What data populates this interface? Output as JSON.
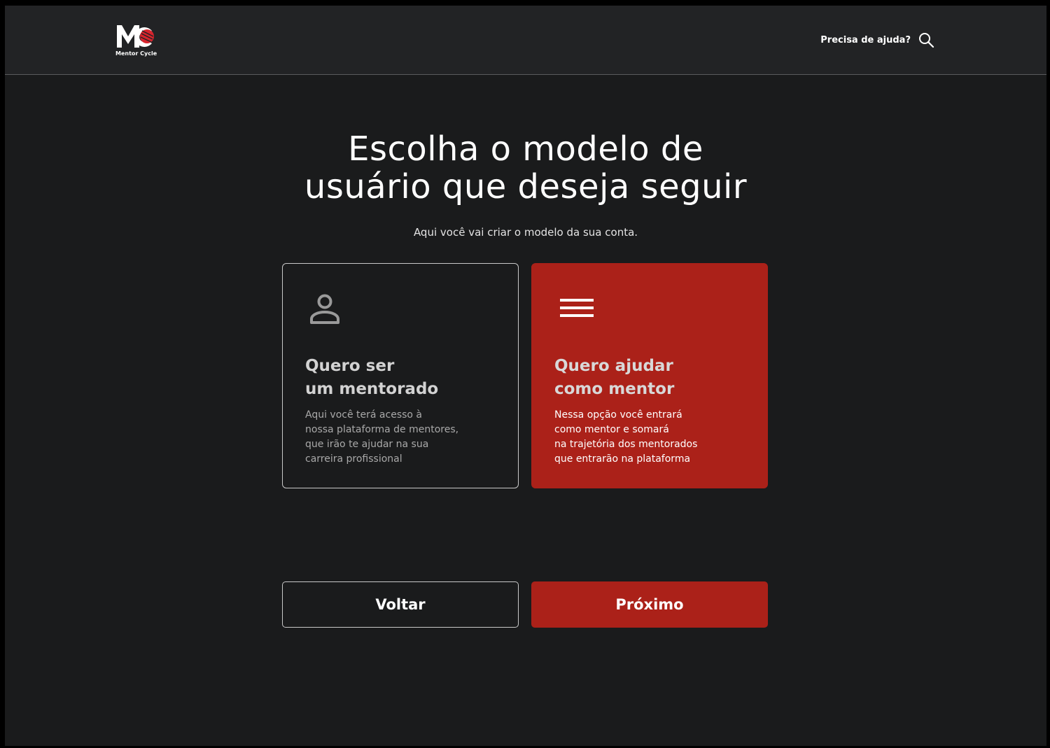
{
  "header": {
    "logo_caption": "Mentor Cycle",
    "help_text": "Precisa de ajuda?",
    "help_icon": "search-icon"
  },
  "main": {
    "title_line1": "Escolha o modelo de",
    "title_line2": "usuário que deseja seguir",
    "subtitle": "Aqui você vai criar o modelo da sua conta."
  },
  "options": [
    {
      "icon": "user-icon",
      "title_line1": "Quero ser",
      "title_line2": "um mentorado",
      "description": "Aqui você terá acesso à\nnossa plataforma de mentores,\nque irão te ajudar na sua\ncarreira profissional",
      "selected": false
    },
    {
      "icon": "menu-icon",
      "title_line1": "Quero ajudar",
      "title_line2": "como mentor",
      "description": "Nessa opção você entrará\ncomo mentor e somará\nna trajetória dos mentorados\nque entrarão na plataforma",
      "selected": true
    }
  ],
  "actions": {
    "back_label": "Voltar",
    "next_label": "Próximo"
  },
  "colors": {
    "accent": "#ab2119",
    "background": "#1a1b1c",
    "header_background": "#222325"
  }
}
